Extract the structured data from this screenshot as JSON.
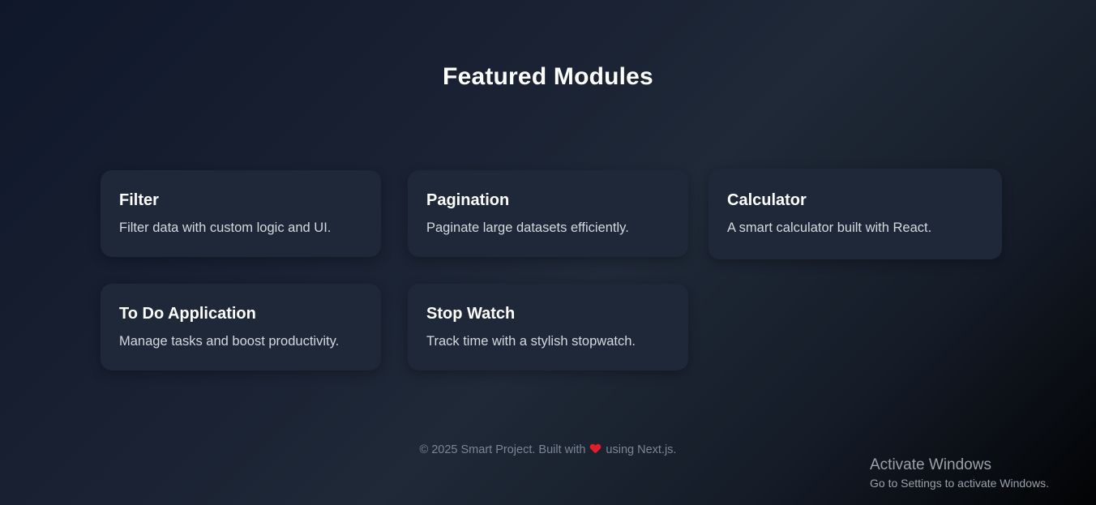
{
  "page": {
    "title": "Featured Modules"
  },
  "cards": [
    {
      "title": "Filter",
      "description": "Filter data with custom logic and UI."
    },
    {
      "title": "Pagination",
      "description": "Paginate large datasets efficiently."
    },
    {
      "title": "Calculator",
      "description": "A smart calculator built with React."
    },
    {
      "title": "To Do Application",
      "description": "Manage tasks and boost productivity."
    },
    {
      "title": "Stop Watch",
      "description": "Track time with a stylish stopwatch."
    }
  ],
  "footer": {
    "prefix": "© 2025 Smart Project. Built with",
    "icon": "heart-icon",
    "suffix": "using Next.js."
  },
  "watermark": {
    "title": "Activate Windows",
    "subtitle": "Go to Settings to activate Windows."
  },
  "colors": {
    "card_background": "#1f2838",
    "heart": "#e11d2e",
    "footer_text": "#7d8594"
  }
}
